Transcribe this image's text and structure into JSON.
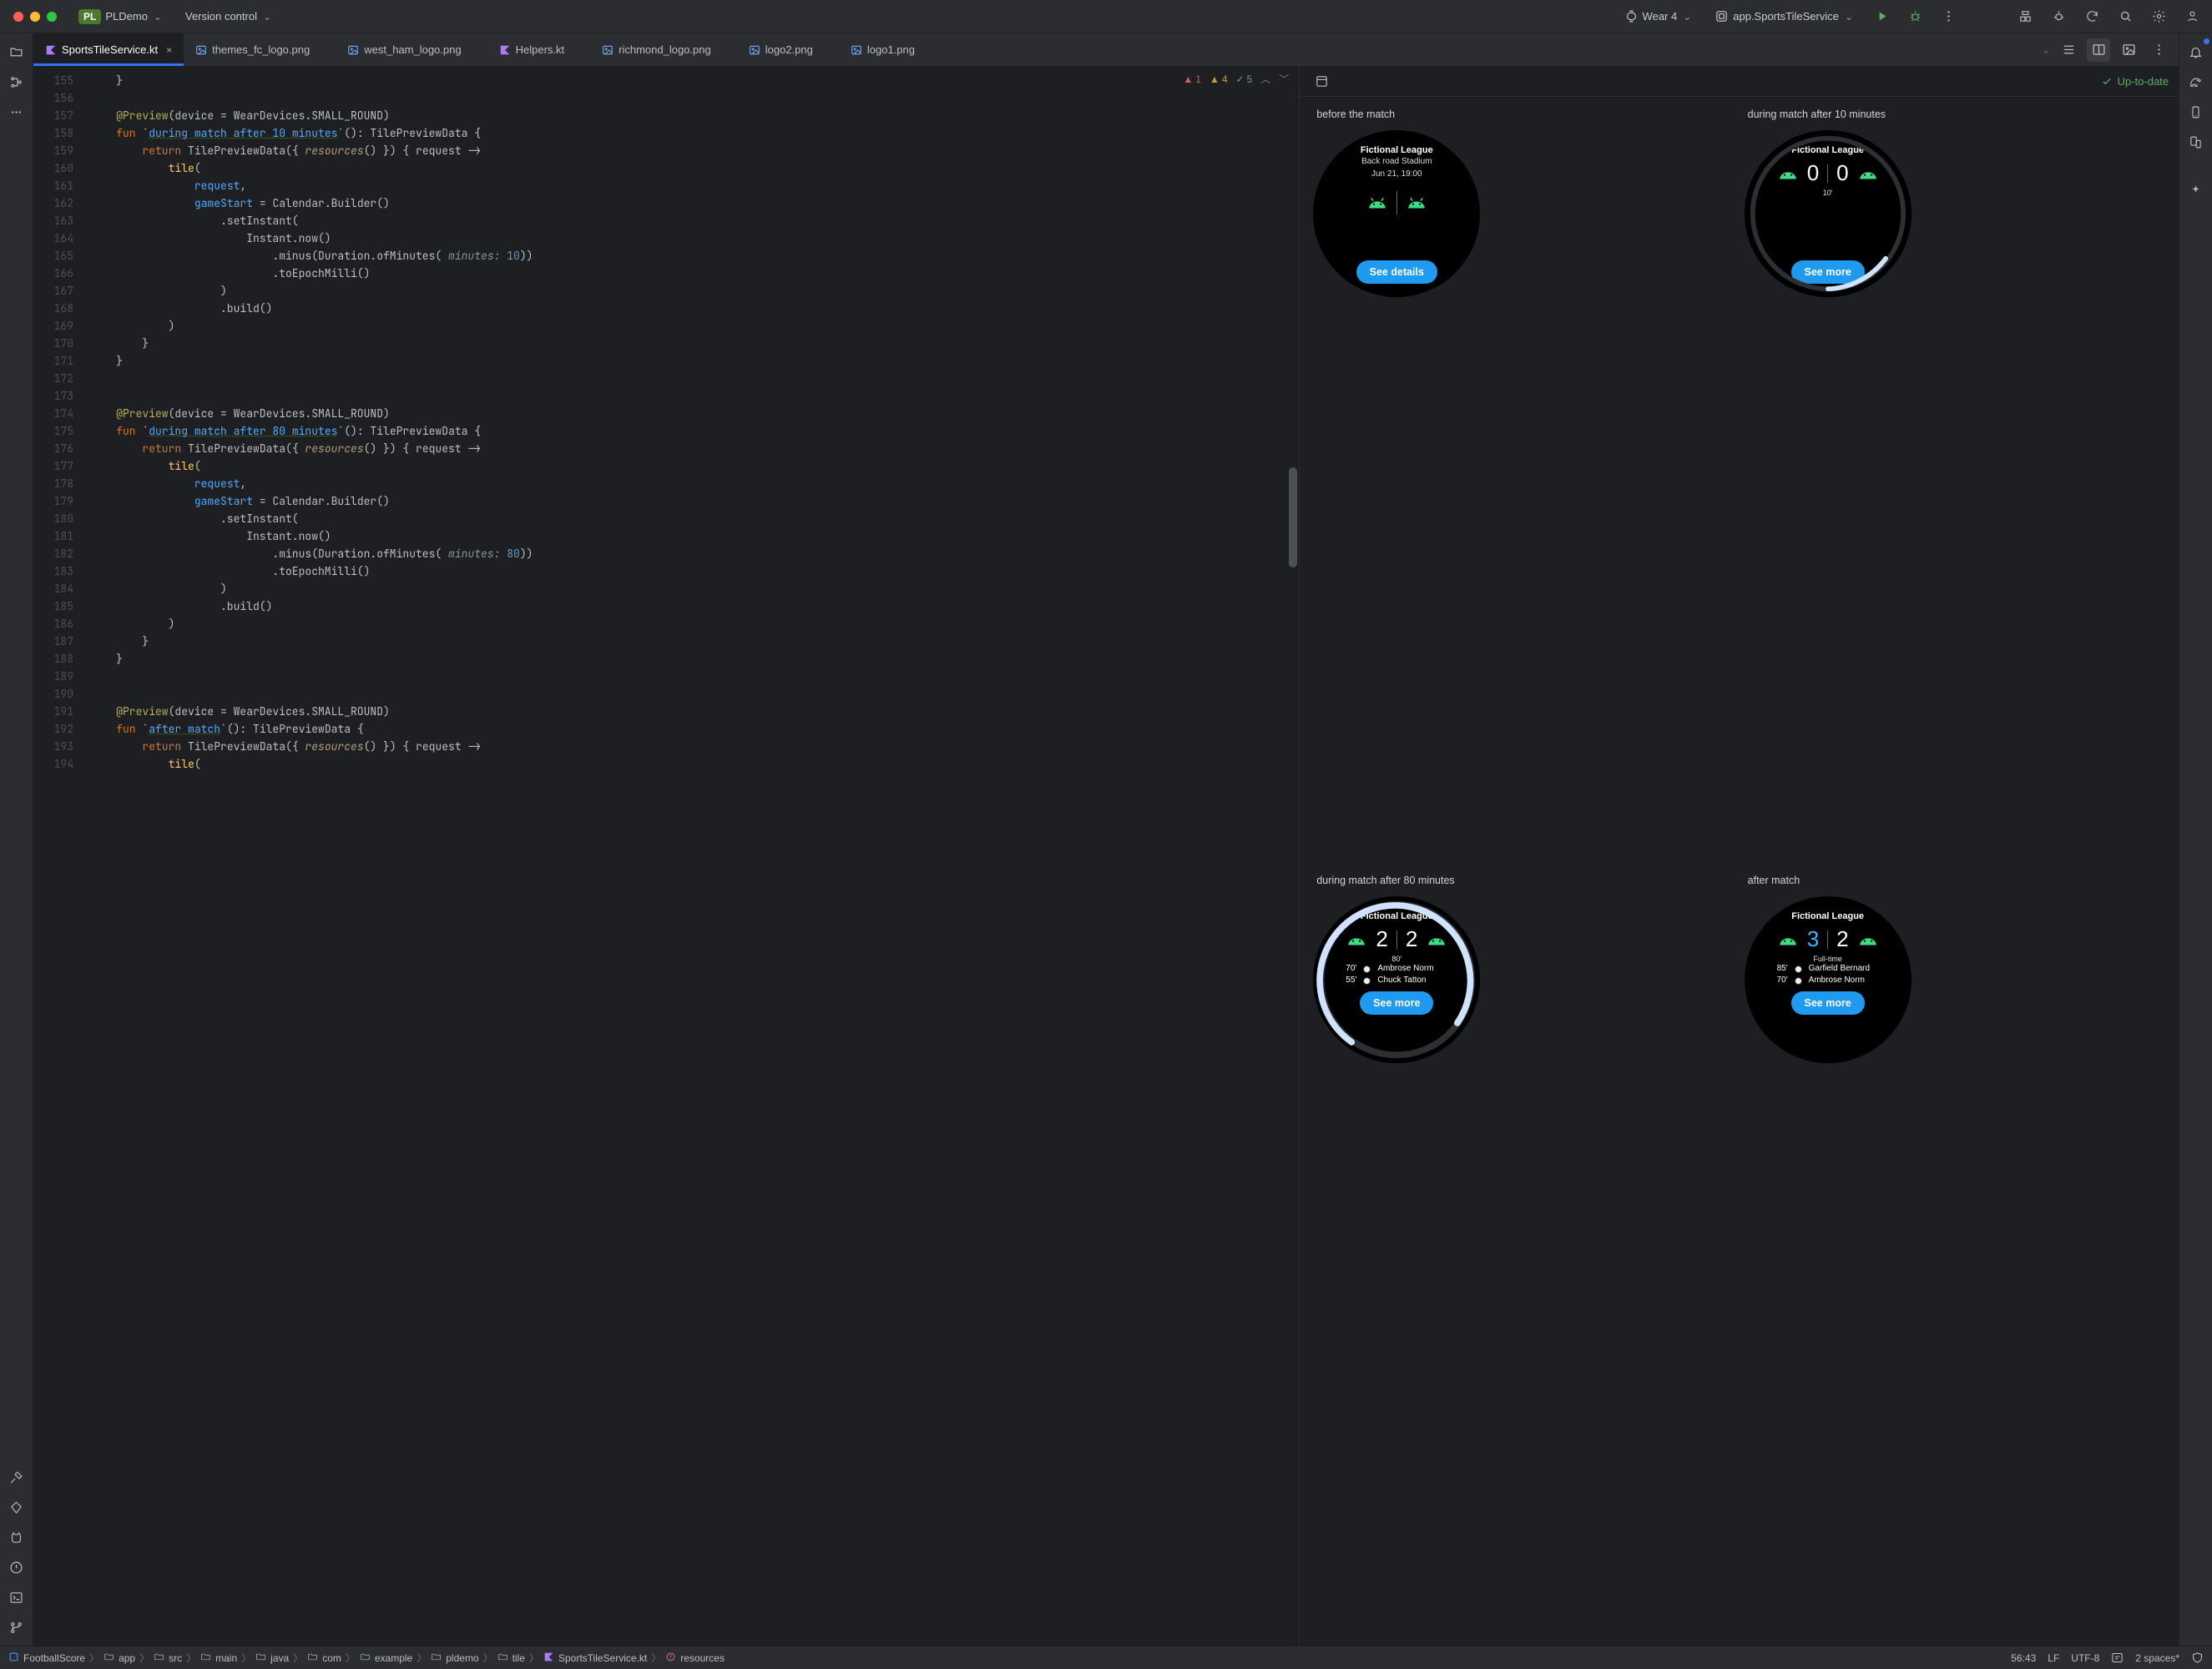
{
  "titlebar": {
    "project_badge": "PL",
    "project_name": "PLDemo",
    "vcs_label": "Version control",
    "device_target": "Wear 4",
    "run_config": "app.SportsTileService"
  },
  "tabs": [
    {
      "name": "SportsTileService.kt",
      "icon": "kt",
      "active": true
    },
    {
      "name": "themes_fc_logo.png",
      "icon": "img",
      "active": false
    },
    {
      "name": "west_ham_logo.png",
      "icon": "img",
      "active": false
    },
    {
      "name": "Helpers.kt",
      "icon": "kt",
      "active": false
    },
    {
      "name": "richmond_logo.png",
      "icon": "img",
      "active": false
    },
    {
      "name": "logo2.png",
      "icon": "img",
      "active": false
    },
    {
      "name": "logo1.png",
      "icon": "img",
      "active": false
    }
  ],
  "inspections": {
    "errors": "1",
    "warnings": "4",
    "oks": "5"
  },
  "editor": {
    "first_line_no": 155,
    "lines": [
      "    }",
      "",
      "    @Preview(device = WearDevices.SMALL_ROUND)",
      "    fun `during match after 10 minutes`(): TilePreviewData {",
      "        return TilePreviewData({ resources() }) { request ->",
      "            tile(",
      "                request,",
      "                gameStart = Calendar.Builder()",
      "                    .setInstant(",
      "                        Instant.now()",
      "                            .minus(Duration.ofMinutes( minutes: 10))",
      "                            .toEpochMilli()",
      "                    )",
      "                    .build()",
      "            )",
      "        }",
      "    }",
      "",
      "",
      "    @Preview(device = WearDevices.SMALL_ROUND)",
      "    fun `during match after 80 minutes`(): TilePreviewData {",
      "        return TilePreviewData({ resources() }) { request ->",
      "            tile(",
      "                request,",
      "                gameStart = Calendar.Builder()",
      "                    .setInstant(",
      "                        Instant.now()",
      "                            .minus(Duration.ofMinutes( minutes: 80))",
      "                            .toEpochMilli()",
      "                    )",
      "                    .build()",
      "            )",
      "        }",
      "    }",
      "",
      "",
      "    @Preview(device = WearDevices.SMALL_ROUND)",
      "    fun `after match`(): TilePreviewData {",
      "        return TilePreviewData({ resources() }) { request ->",
      "            tile("
    ]
  },
  "preview": {
    "status": "Up-to-date",
    "tiles": [
      {
        "title": "before the match",
        "league": "Fictional League",
        "sub1": "Back road Stadium",
        "sub2": "Jun 21, 19:00",
        "button": "See details"
      },
      {
        "title": "during match after 10 minutes",
        "league": "Fictional League",
        "score_home": "0",
        "score_away": "0",
        "minute": "10'",
        "button": "See more"
      },
      {
        "title": "during match after 80 minutes",
        "league": "Fictional League",
        "score_home": "2",
        "score_away": "2",
        "minute": "80'",
        "events": [
          {
            "t": "70'",
            "name": "Ambrose Norm"
          },
          {
            "t": "55'",
            "name": "Chuck Tatton"
          }
        ],
        "button": "See more"
      },
      {
        "title": "after match",
        "league": "Fictional League",
        "score_home": "3",
        "score_away": "2",
        "minute": "Full-time",
        "events": [
          {
            "t": "85'",
            "name": "Garfield Bernard"
          },
          {
            "t": "70'",
            "name": "Ambrose Norm"
          }
        ],
        "button": "See more"
      }
    ]
  },
  "breadcrumbs": [
    "FootballScore",
    "app",
    "src",
    "main",
    "java",
    "com",
    "example",
    "pldemo",
    "tile",
    "SportsTileService.kt",
    "resources"
  ],
  "statusbar": {
    "caret": "56:43",
    "line_sep": "LF",
    "encoding": "UTF-8",
    "indent": "2 spaces*"
  }
}
